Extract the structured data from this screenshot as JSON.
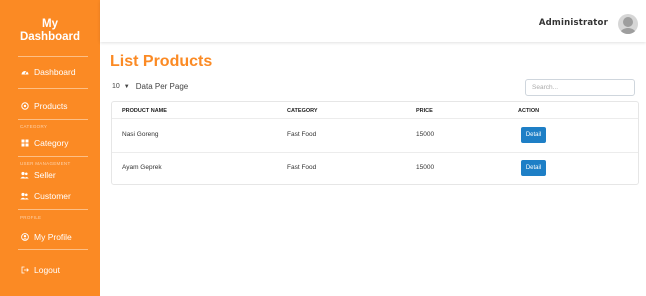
{
  "sidebar": {
    "brand_line1": "My",
    "brand_line2": "Dashboard",
    "dashboard": "Dashboard",
    "products": "Products",
    "section_category": "CATEGORY",
    "category": "Category",
    "section_user_management": "USER MANAGEMENT",
    "seller": "Seller",
    "customer": "Customer",
    "section_profile": "PROFILE",
    "my_profile": "My Profile",
    "logout": "Logout"
  },
  "topbar": {
    "user_name": "Administrator"
  },
  "main": {
    "title": "List Products",
    "per_page_value": "10",
    "per_page_label": "Data Per Page",
    "search_placeholder": "Search..."
  },
  "table": {
    "columns": [
      "PRODUCT NAME",
      "CATEGORY",
      "PRICE",
      "ACTION"
    ],
    "rows": [
      {
        "name": "Nasi Goreng",
        "category": "Fast Food",
        "price": "15000",
        "action": "Detail"
      },
      {
        "name": "Ayam Geprek",
        "category": "Fast Food",
        "price": "15000",
        "action": "Detail"
      }
    ]
  },
  "colors": {
    "accent": "#fb8a24",
    "button": "#1e7fc6"
  },
  "icons": {
    "dashboard": "dashboard-icon",
    "products": "products-icon",
    "category": "grid-icon",
    "seller": "users-icon",
    "customer": "users-icon",
    "profile": "user-circle-icon",
    "logout": "logout-icon"
  }
}
